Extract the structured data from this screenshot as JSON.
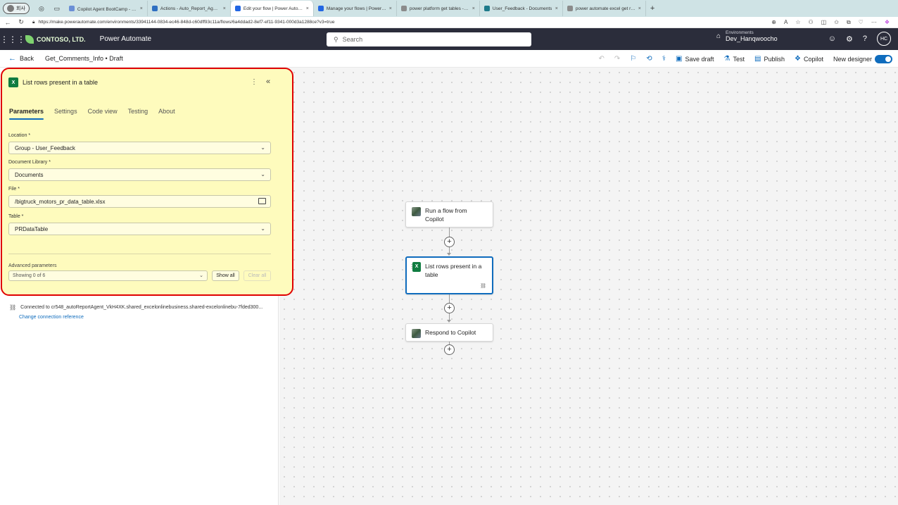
{
  "browser": {
    "profile": "회사",
    "tabs": [
      {
        "label": "Copilot Agent BootCamp - 한국",
        "color": "#6b8fd6",
        "active": false
      },
      {
        "label": "Actions - Auto_Report_Agent |",
        "color": "#2f6fc1",
        "active": false
      },
      {
        "label": "Edit your flow | Power Automat",
        "color": "#2266e3",
        "active": true
      },
      {
        "label": "Manage your flows | Power Au",
        "color": "#2266e3",
        "active": false
      },
      {
        "label": "power platform get tables - Se",
        "color": "#8b8b8b",
        "active": false
      },
      {
        "label": "User_Feedback - Documents",
        "color": "#1d7a8a",
        "active": false
      },
      {
        "label": "power automate excel get rows",
        "color": "#8b8b8b",
        "active": false
      }
    ],
    "url": "https://make.powerautomate.com/environments/33941144-0834-ec46-848d-c60dff93c11a/flows/6a4ddad2-8ef7-ef11-9341-000d3a1288ce?v3=true"
  },
  "header": {
    "org": "CONTOSO, LTD.",
    "product": "Power Automate",
    "search_placeholder": "Search",
    "env_label": "Environments",
    "env_name": "Dev_Hanqwoocho",
    "avatar": "HC"
  },
  "command_bar": {
    "back_label": "Back",
    "flow_title": "Get_Comments_Info • Draft",
    "save_draft": "Save draft",
    "test": "Test",
    "publish": "Publish",
    "copilot": "Copilot",
    "new_designer": "New designer"
  },
  "panel": {
    "title": "List rows present in a table",
    "tabs": [
      "Parameters",
      "Settings",
      "Code view",
      "Testing",
      "About"
    ],
    "location_label": "Location *",
    "location_value": "Group - User_Feedback",
    "library_label": "Document Library *",
    "library_value": "Documents",
    "file_label": "File *",
    "file_value": "/bigtruck_motors_pr_data_table.xlsx",
    "table_label": "Table *",
    "table_value": "PRDataTable",
    "advanced_label": "Advanced parameters",
    "advanced_value": "Showing 0 of 6",
    "show_all": "Show all",
    "clear_all": "Clear all",
    "connection_text": "Connected to cr548_autoReportAgent_VkH4XK.shared_excelonlinebusiness.shared-excelonlinebu-7fded300...",
    "change_connection": "Change connection reference"
  },
  "canvas": {
    "trigger": "Run a flow from Copilot",
    "action": "List rows present in a table",
    "respond": "Respond to Copilot"
  }
}
